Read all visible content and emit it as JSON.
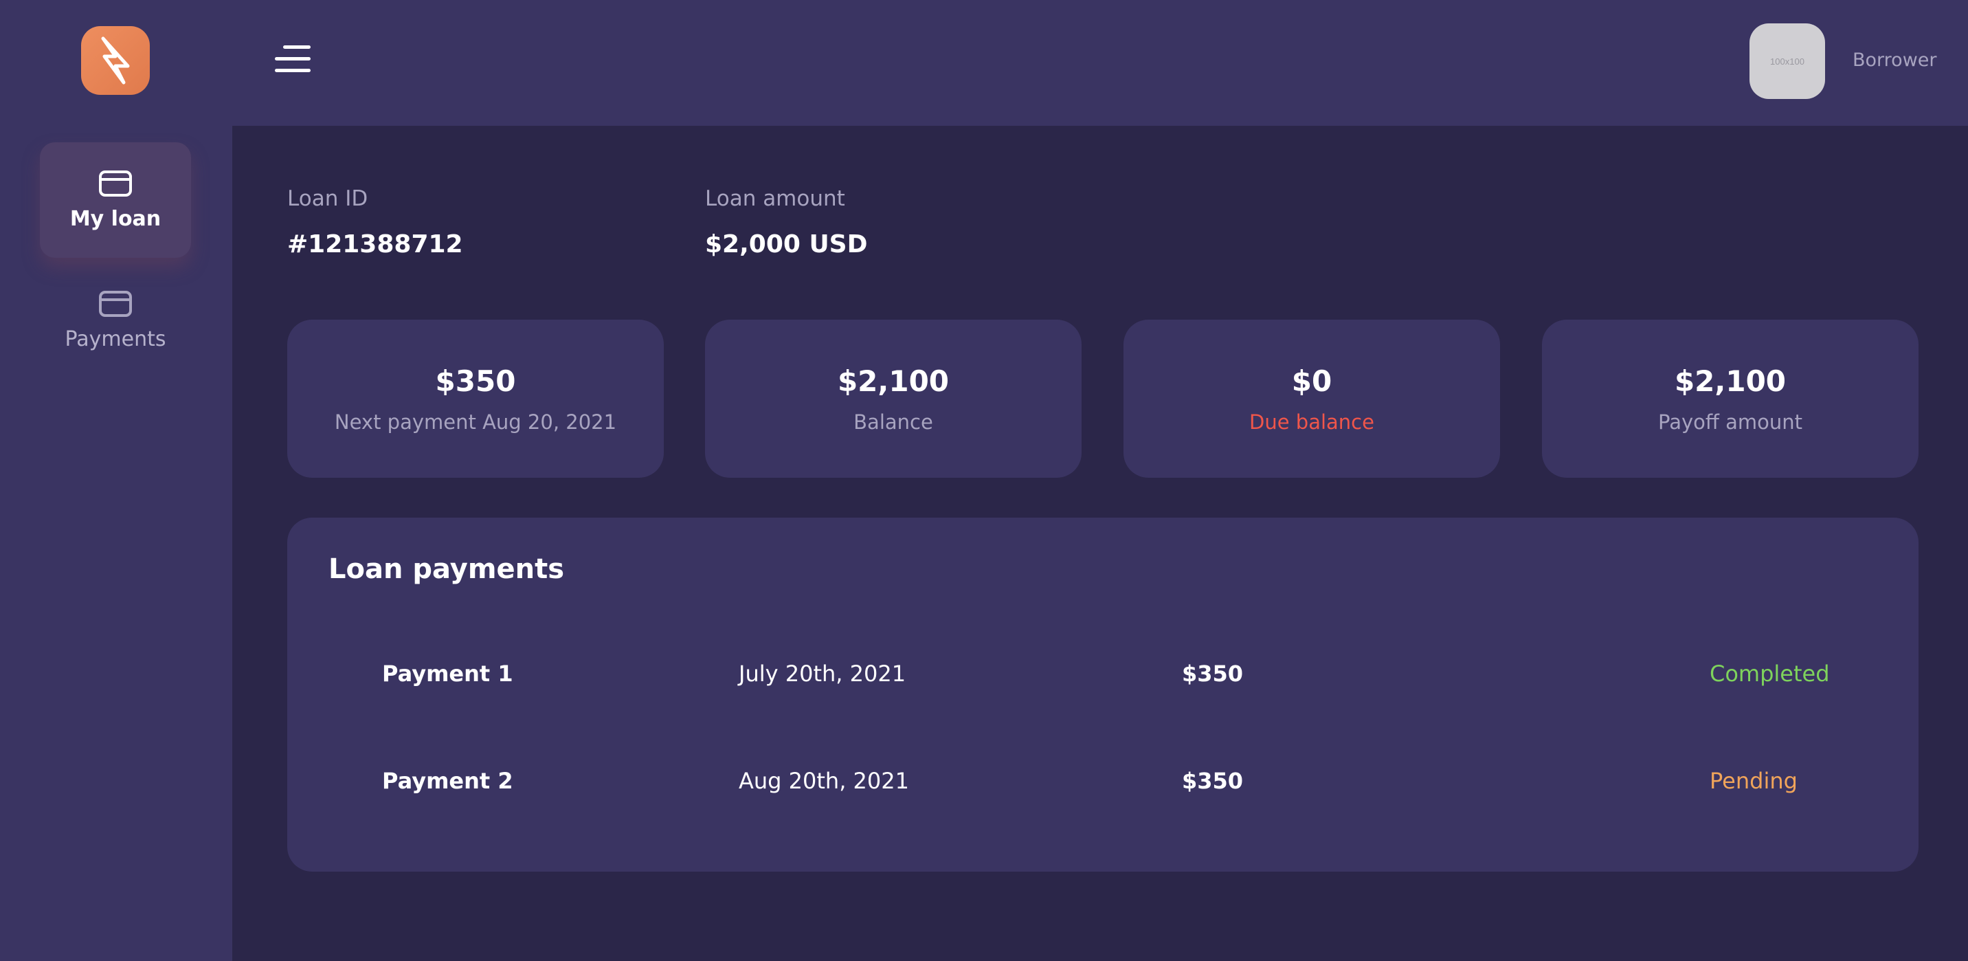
{
  "sidebar": {
    "logo_icon": "bolt-logo-icon",
    "items": [
      {
        "label": "My loan",
        "icon": "card-icon",
        "active": true
      },
      {
        "label": "Payments",
        "icon": "card-icon",
        "active": false
      }
    ]
  },
  "header": {
    "menu_icon": "hamburger-menu-icon",
    "avatar_placeholder": "100x100",
    "user_name": "Borrower"
  },
  "loan": {
    "id_label": "Loan ID",
    "id_value": "#121388712",
    "amount_label": "Loan amount",
    "amount_value": "$2,000 USD"
  },
  "stats": [
    {
      "value": "$350",
      "label": "Next payment Aug 20, 2021"
    },
    {
      "value": "$2,100",
      "label": "Balance"
    },
    {
      "value": "$0",
      "label": "Due balance",
      "label_color": "#f0564a"
    },
    {
      "value": "$2,100",
      "label": "Payoff amount"
    }
  ],
  "payments": {
    "title": "Loan payments",
    "rows": [
      {
        "name": "Payment 1",
        "date": "July 20th, 2021",
        "amount": "$350",
        "status": "Completed",
        "status_color": "#7ed35c"
      },
      {
        "name": "Payment 2",
        "date": "Aug 20th, 2021",
        "amount": "$350",
        "status": "Pending",
        "status_color": "#f0a45a"
      }
    ]
  },
  "colors": {
    "background": "#2b2649",
    "panel": "#3a3462",
    "accent": "#e8845a",
    "muted_text": "#a8a4c0"
  }
}
